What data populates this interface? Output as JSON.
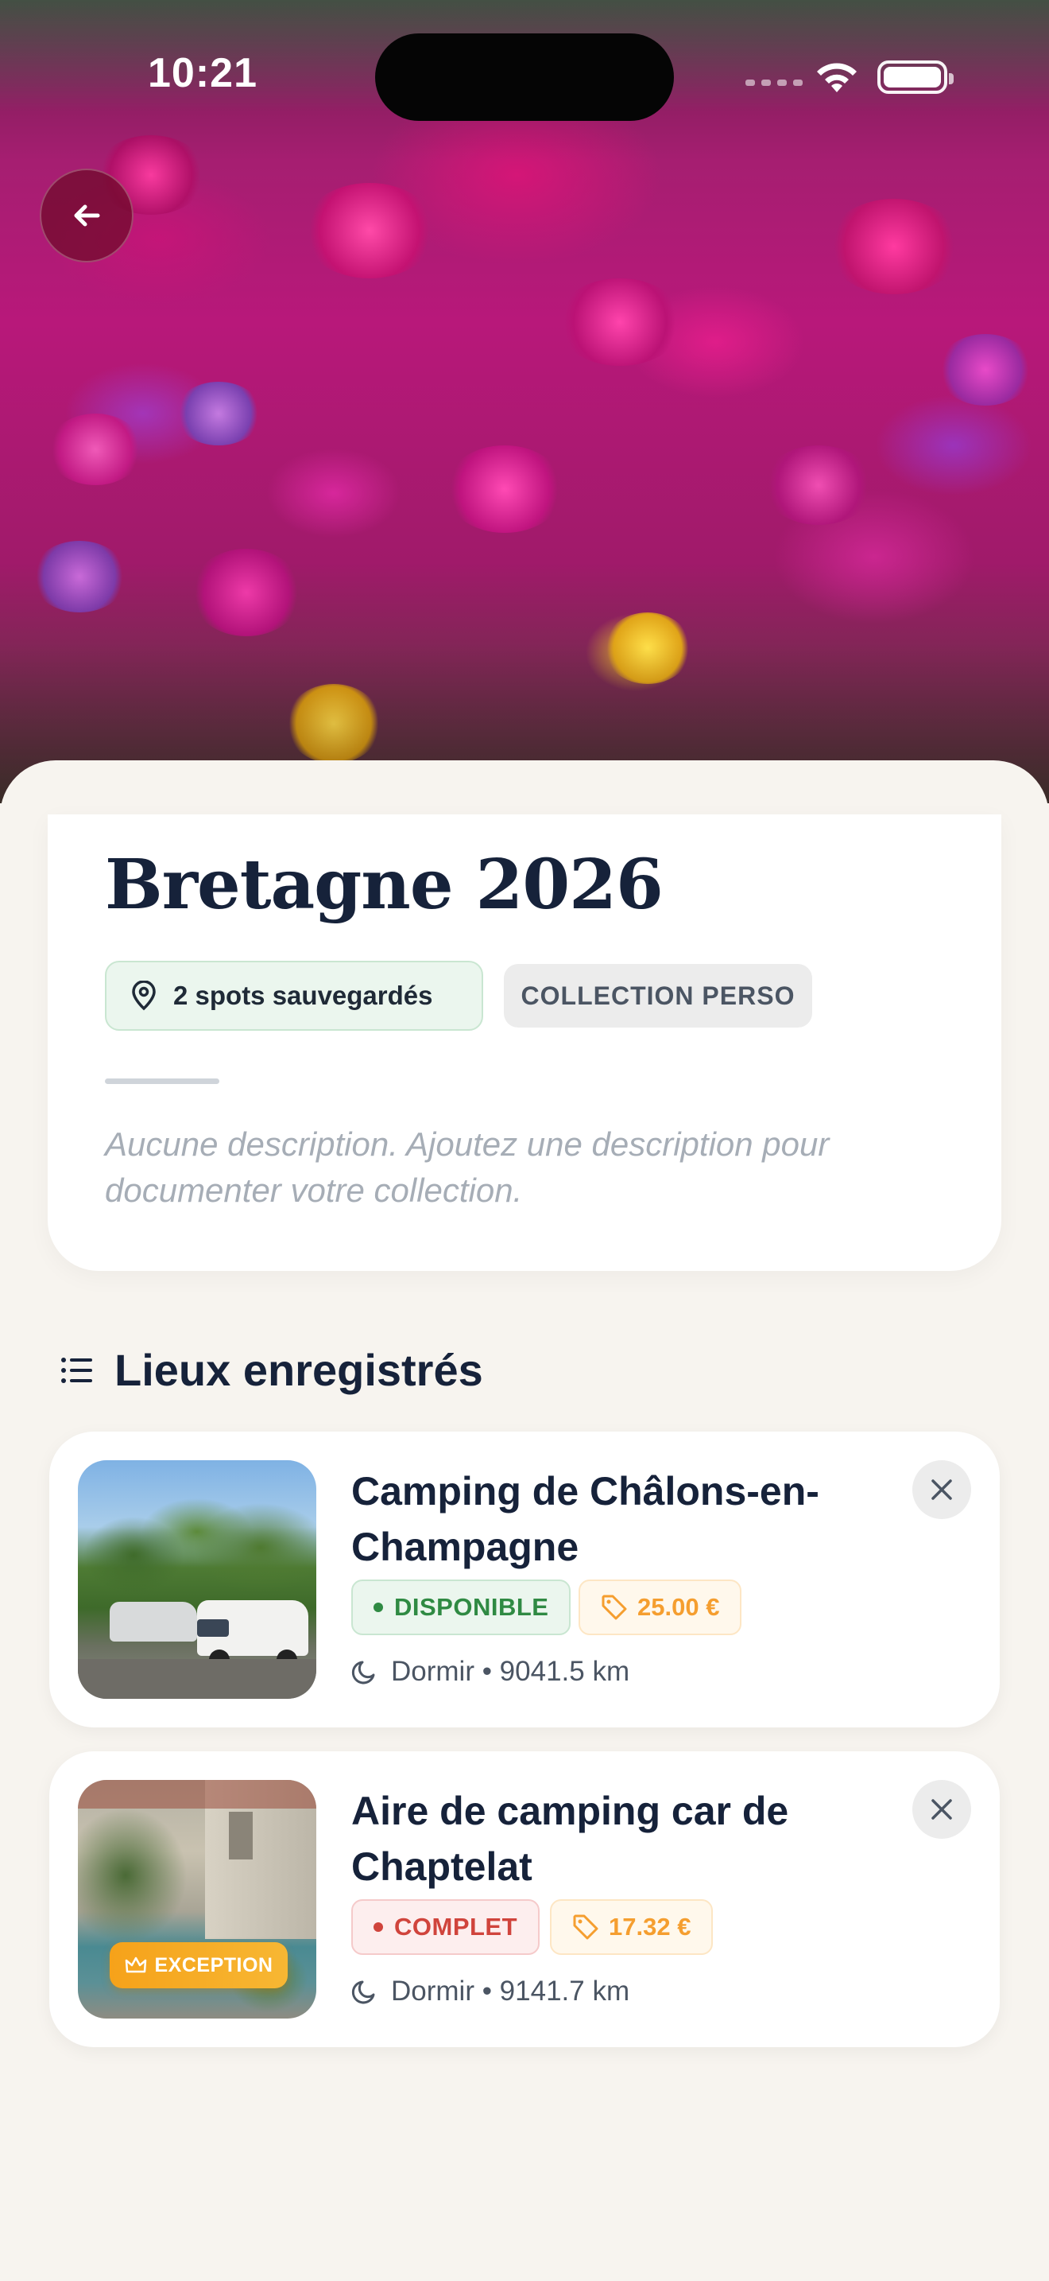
{
  "status_bar": {
    "time": "10:21"
  },
  "collection": {
    "title": "Bretagne 2026",
    "spots_chip": "2 spots sauvegardés",
    "type_chip": "COLLECTION PERSO",
    "description": "Aucune description. Ajoutez une description pour documenter votre collection."
  },
  "section": {
    "title": "Lieux enregistrés"
  },
  "places": [
    {
      "name": "Camping de Châlons-en-Champagne",
      "status": "DISPONIBLE",
      "status_color": "#2f8a43",
      "price": "25.00 €",
      "category": "Dormir",
      "distance": "9041.5 km",
      "meta": "Dormir • 9041.5 km"
    },
    {
      "name": "Aire de camping car de Chaptelat",
      "status": "COMPLET",
      "status_color": "#d0443c",
      "price": "17.32 €",
      "category": "Dormir",
      "distance": "9141.7 km",
      "meta": "Dormir • 9141.7 km",
      "badge": "EXCEPTION"
    }
  ],
  "icons": {
    "back": "arrow-left-icon",
    "pin": "map-pin-icon",
    "list": "list-icon",
    "close": "close-icon",
    "tag": "tag-icon",
    "moon": "moon-icon",
    "crown": "crown-icon",
    "wifi": "wifi-icon",
    "battery": "battery-icon"
  },
  "colors": {
    "background": "#f7f4ef",
    "title": "#16223a",
    "available": "#2f8a43",
    "full": "#d0443c",
    "price": "#f59e2f",
    "exception": "#f6a21a"
  }
}
